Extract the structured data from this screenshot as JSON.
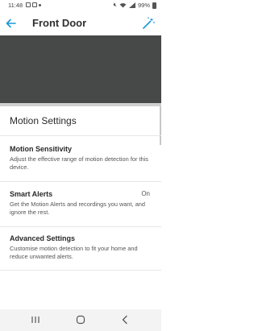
{
  "status_bar": {
    "time": "11:48",
    "battery": "99%"
  },
  "header": {
    "title": "Front Door"
  },
  "section": {
    "title": "Motion Settings"
  },
  "settings": [
    {
      "title": "Motion Sensitivity",
      "description": "Adjust the effective range of motion detection for this device.",
      "value": ""
    },
    {
      "title": "Smart Alerts",
      "description": "Get the Motion Alerts and recordings you want, and ignore the rest.",
      "value": "On"
    },
    {
      "title": "Advanced Settings",
      "description": "Customise motion detection to fit your home and reduce unwanted alerts.",
      "value": ""
    }
  ],
  "icons": {
    "back": "back-arrow-icon",
    "wand": "magic-wand-icon",
    "recents": "recents-icon",
    "home": "home-icon",
    "nav_back": "nav-back-icon"
  },
  "colors": {
    "accent": "#1998d5",
    "preview": "#474848"
  }
}
